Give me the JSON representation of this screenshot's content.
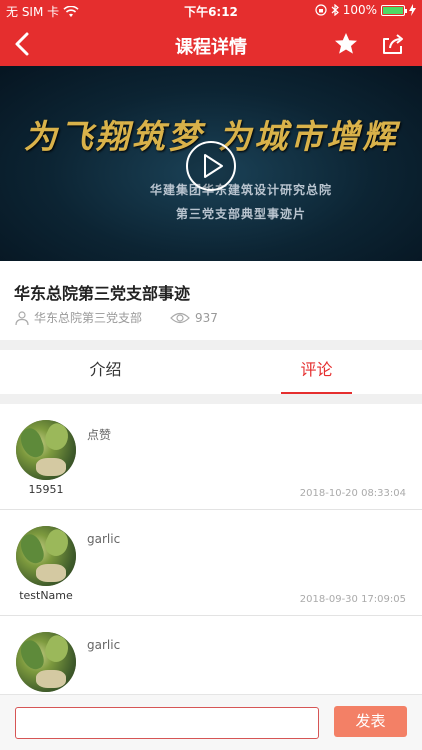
{
  "status_bar": {
    "carrier": "无 SIM 卡",
    "time": "下午6:12",
    "battery": "100%"
  },
  "nav": {
    "title": "课程详情"
  },
  "video": {
    "headline": "为飞翔筑梦 为城市增辉",
    "subtitle_1": "华建集团华东建筑设计研究总院",
    "subtitle_2": "第三党支部典型事迹片"
  },
  "course": {
    "title": "华东总院第三党支部事迹",
    "author": "华东总院第三党支部",
    "views": "937"
  },
  "tabs": [
    {
      "label": "介绍"
    },
    {
      "label": "评论"
    }
  ],
  "comments": [
    {
      "name": "15951",
      "text": "点赞",
      "time": "2018-10-20 08:33:04"
    },
    {
      "name": "testName",
      "text": "garlic",
      "time": "2018-09-30 17:09:05"
    },
    {
      "name": "",
      "text": "garlic",
      "time": ""
    }
  ],
  "composer": {
    "send_label": "发表",
    "placeholder": ""
  },
  "colors": {
    "accent": "#e52e2e",
    "send_button": "#f38066"
  }
}
